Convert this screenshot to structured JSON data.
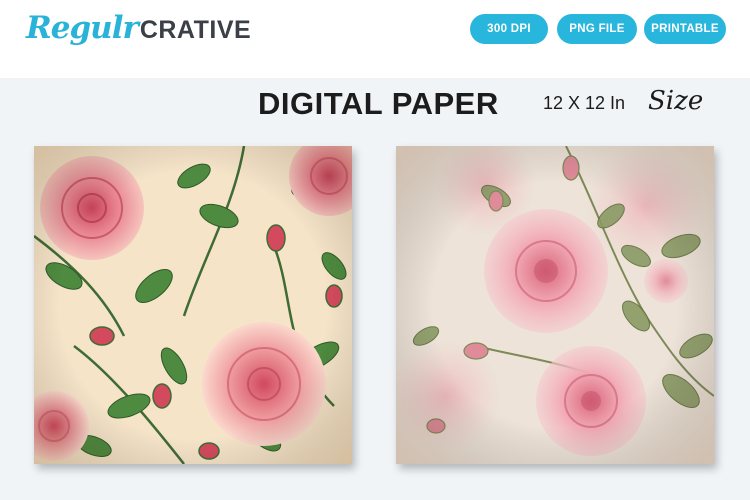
{
  "brand": {
    "script": "Regulr",
    "bold": "CRATIVE"
  },
  "badges": [
    "300 DPI",
    "PNG FILE",
    "PRINTABLE"
  ],
  "title": "DIGITAL PAPER",
  "size": {
    "label": "12 X 12 In",
    "script": "Size"
  },
  "colors": {
    "accent": "#29b6dc",
    "dark_text": "#1c1c1c",
    "background": "#f1f4f7"
  },
  "papers": [
    {
      "name": "vintage-rose-pattern-cream",
      "base": "#f5e4c8"
    },
    {
      "name": "watercolor-rose-pattern-pink",
      "base": "#ede3d8"
    }
  ]
}
